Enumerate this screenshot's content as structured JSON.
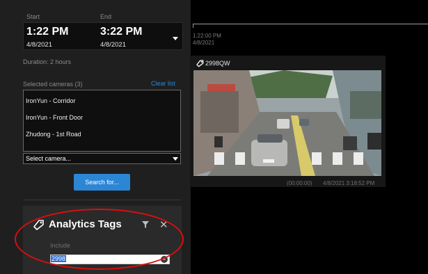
{
  "search": {
    "start_label": "Start",
    "end_label": "End",
    "start_time": "1:22 PM",
    "start_date": "4/8/2021",
    "end_time": "3:22 PM",
    "end_date": "4/8/2021",
    "duration": "Duration: 2 hours",
    "selected_cameras_label": "Selected cameras (3)",
    "clear_list": "Clear list",
    "cameras": [
      "IronYun - Corridor",
      "IronYun - Front Door",
      "Zhudong - 1st Road"
    ],
    "select_placeholder": "Select camera...",
    "search_button": "Search for..."
  },
  "analytics_tags": {
    "title": "Analytics Tags",
    "include_label": "Include",
    "input_value": "2998"
  },
  "results": {
    "timeline_time": "1:22:00 PM",
    "timeline_date": "4/8/2021",
    "thumb_tag": "2998QW",
    "thumb_offset": "(00:00:00)",
    "thumb_timestamp": "4/8/2021 3:18:52 PM"
  },
  "colors": {
    "accent": "#2c86d6",
    "annotation": "#e00d0d",
    "panel": "#1f1f1f",
    "background": "#000000"
  }
}
